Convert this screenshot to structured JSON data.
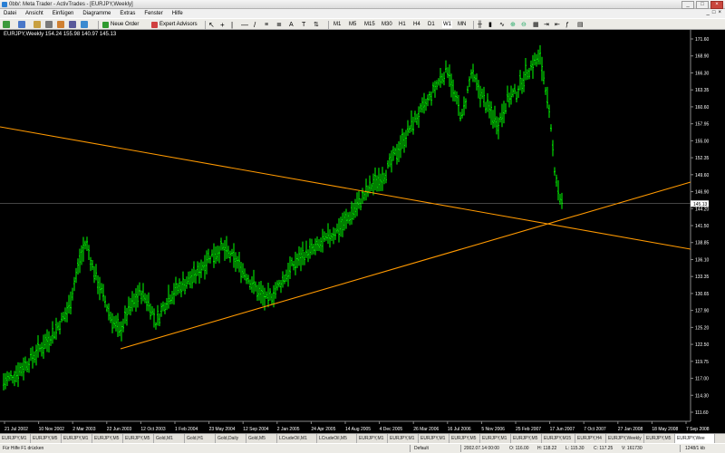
{
  "window": {
    "title": "0bb/: Meta Trader - ActivTrades - [EURJPY,Weekly]",
    "buttons": [
      "_",
      "□",
      "×"
    ]
  },
  "menu": {
    "items": [
      "Datei",
      "Ansicht",
      "Einfügen",
      "Diagramme",
      "Extras",
      "Fenster",
      "Hilfe"
    ],
    "mdi_buttons": [
      "_",
      "□",
      "×"
    ]
  },
  "toolbar": {
    "new_order": "Neue Order",
    "expert_advisors": "Expert Advisors",
    "timeframes": [
      "M1",
      "M5",
      "M15",
      "M30",
      "H1",
      "H4",
      "D1",
      "W1",
      "MN"
    ]
  },
  "chart": {
    "symbol_info": "EURJPY,Weekly  154.24 155.98 140.97 145.13",
    "current_price_label": "145.13",
    "price_labels": [
      "171.60",
      "168.90",
      "166.30",
      "163.35",
      "160.60",
      "157.95",
      "155.00",
      "152.35",
      "149.60",
      "146.90",
      "144.20",
      "141.50",
      "138.85",
      "136.10",
      "133.35",
      "130.65",
      "127.90",
      "125.20",
      "122.50",
      "119.75",
      "117.00",
      "114.30",
      "111.60"
    ],
    "date_labels": [
      "21 Jul 2002",
      "10 Nov 2002",
      "2 Mar 2003",
      "22 Jun 2003",
      "12 Oct 2003",
      "1 Feb 2004",
      "23 May 2004",
      "12 Sep 2004",
      "2 Jan 2005",
      "24 Apr 2005",
      "14 Aug 2005",
      "4 Dec 2005",
      "26 Mar 2006",
      "16 Jul 2006",
      "5 Nov 2006",
      "25 Feb 2007",
      "17 Jun 2007",
      "7 Oct 2007",
      "27 Jan 2008",
      "18 May 2008",
      "7 Sep 2008"
    ],
    "colors": {
      "background": "#000000",
      "bars": "#00ff00",
      "trendline": "#ff9900",
      "hline": "#888888"
    }
  },
  "tabs": [
    "EURJPY,M1",
    "EURJPY,M5",
    "EURJPY,M1",
    "EURJPY,M5",
    "EURJPY,M5",
    "Gold,M1",
    "Gold,H1",
    "Gold,Daily",
    "Gold,M5",
    "LCrudeOil,M1",
    "LCrudeOil,M5",
    "EURJPY,M1",
    "EURJPY,M1",
    "EURJPY,M1",
    "EURJPY,M5",
    "EURJPY,M1",
    "EURJPY,M5",
    "EURJPY,M15",
    "EURJPY,H4",
    "EURJPY,Weekly",
    "EURJPY,M5",
    "EURJPY,Wee"
  ],
  "status": {
    "help": "Für Hilfe F1 drücken",
    "profile": "Default",
    "datetime": "2002.07.14 00:00",
    "open": "O: 116.00",
    "high": "H: 118.22",
    "low": "L: 115.30",
    "close": "C: 117.25",
    "volume": "V: 161730",
    "traffic": "1248/1 kb"
  }
}
